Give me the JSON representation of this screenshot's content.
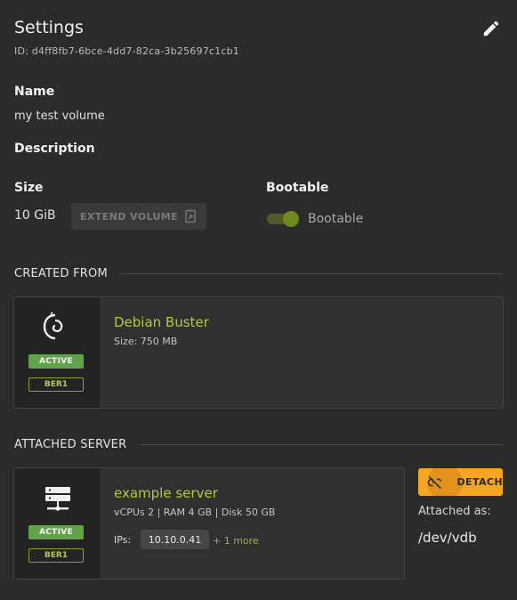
{
  "header": {
    "title": "Settings",
    "id_text": "ID: d4ff8fb7-6bce-4dd7-82ca-3b25697c1cb1",
    "edit_icon": "pencil-icon"
  },
  "name": {
    "label": "Name",
    "value": "my test volume"
  },
  "description": {
    "label": "Description"
  },
  "size": {
    "label": "Size",
    "value": "10 GiB",
    "extend_label": "EXTEND VOLUME",
    "extend_icon": "resize-icon"
  },
  "bootable": {
    "label": "Bootable",
    "toggle_label": "Bootable",
    "enabled": true
  },
  "created_from": {
    "header": "CREATED FROM",
    "card": {
      "icon": "debian-icon",
      "status": "ACTIVE",
      "region": "BER1",
      "title": "Debian Buster",
      "subtitle": "Size: 750 MB"
    }
  },
  "attached_server": {
    "header": "ATTACHED SERVER",
    "card": {
      "icon": "server-icon",
      "status": "ACTIVE",
      "region": "BER1",
      "title": "example server",
      "specs": "vCPUs 2 | RAM 4 GB | Disk 50 GB",
      "ips_label": "IPs:",
      "ip": "10.10.0.41",
      "more": "+ 1 more"
    },
    "detach_label": "DETACH",
    "detach_icon": "unlink-icon",
    "attached_as_label": "Attached as:",
    "device": "/dev/vdb"
  },
  "colors": {
    "accent": "#b3ca3d",
    "active": "#62a34a",
    "detach": "#f4a623",
    "background": "#2b2b2b"
  }
}
